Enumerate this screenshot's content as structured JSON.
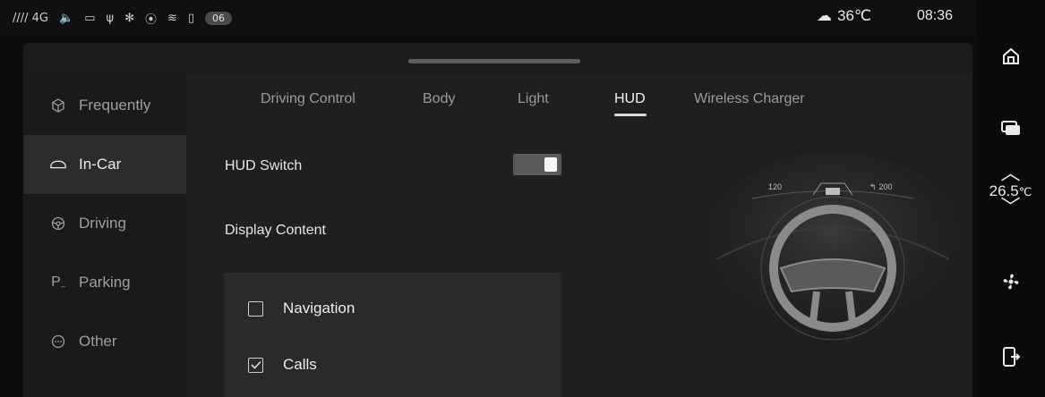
{
  "status_bar": {
    "signal": "//// 4G",
    "badge": "06",
    "weather_temp": "36℃",
    "time": "08:36"
  },
  "dock": {
    "cabin_temp_value": "26.5",
    "cabin_temp_unit": "℃"
  },
  "sidebar": {
    "items": [
      {
        "label": "Frequently",
        "icon": "cube-icon"
      },
      {
        "label": "In-Car",
        "icon": "car-icon"
      },
      {
        "label": "Driving",
        "icon": "steering-wheel-icon"
      },
      {
        "label": "Parking",
        "icon": "parking-icon"
      },
      {
        "label": "Other",
        "icon": "more-icon"
      }
    ],
    "active_index": 1
  },
  "tabs": [
    {
      "label": "Driving Control"
    },
    {
      "label": "Body"
    },
    {
      "label": "Light"
    },
    {
      "label": "HUD"
    },
    {
      "label": "Wireless Charger"
    }
  ],
  "active_tab": "HUD",
  "hud": {
    "switch_label": "HUD Switch",
    "switch_on": true,
    "display_content_label": "Display Content",
    "options": [
      {
        "label": "Navigation",
        "checked": false
      },
      {
        "label": "Calls",
        "checked": true
      }
    ],
    "preview": {
      "speed": "120",
      "distance": "200"
    }
  },
  "colors": {
    "background": "#0d0d0e",
    "panel": "#1f1f21",
    "active_item": "#2c2c2e",
    "text_primary": "#ececec",
    "text_secondary": "#9a9a9a"
  }
}
